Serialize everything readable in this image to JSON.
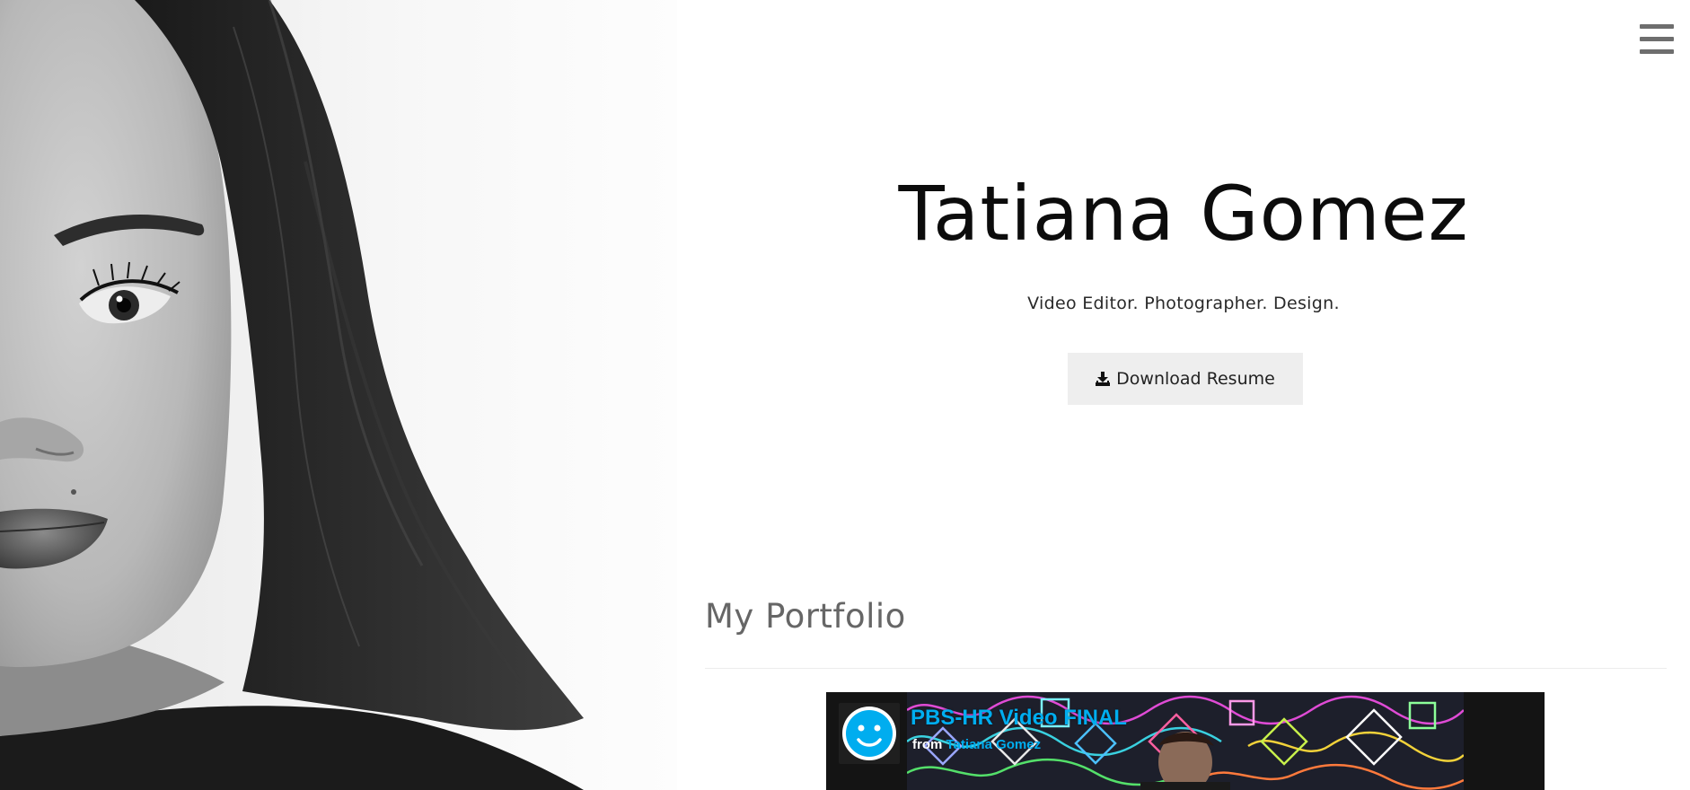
{
  "hero": {
    "name": "Tatiana Gomez",
    "tagline": "Video Editor. Photographer. Design.",
    "resume_button_label": "Download Resume"
  },
  "portfolio": {
    "heading": "My Portfolio",
    "video": {
      "title": "PBS-HR Video FINAL",
      "from_label": "from",
      "author": "Tatiana Gomez"
    }
  },
  "icons": {
    "menu": "hamburger-menu-icon",
    "download": "download-icon",
    "video_badge": "smiley-avatar-icon"
  },
  "colors": {
    "video_accent": "#00adef",
    "resume_button_bg": "#eeeeee",
    "menu_icon": "#6e6e6e"
  }
}
